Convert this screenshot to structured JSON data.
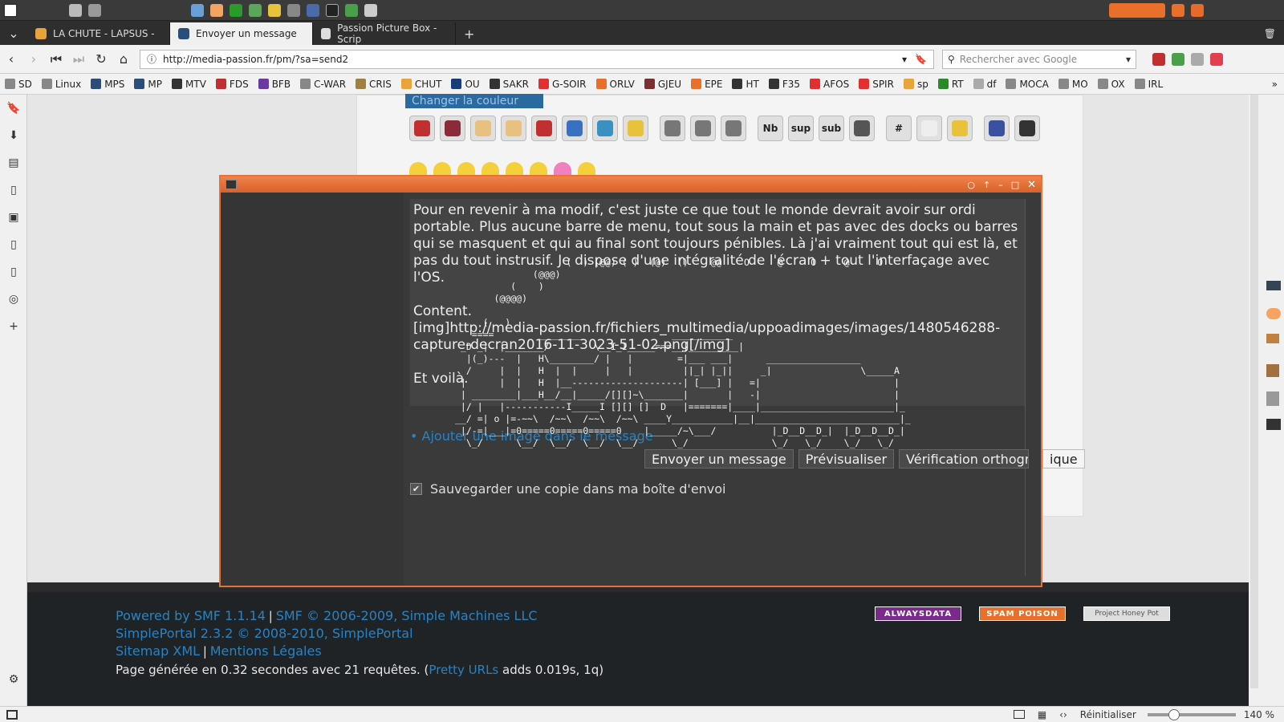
{
  "tabs": [
    {
      "label": "LA CHUTE - LAPSUS -",
      "active": false,
      "fav": "#e8a33a"
    },
    {
      "label": "Envoyer un message",
      "active": true,
      "fav": "#2a4d7a"
    },
    {
      "label": "Passion Picture Box - Scrip",
      "active": false,
      "fav": "#ddd"
    }
  ],
  "nav": {
    "url": "http://media-passion.fr/pm/?sa=send2",
    "search_placeholder": "Rechercher avec Google"
  },
  "bookmarks": [
    "SD",
    "Linux",
    "MPS",
    "MP",
    "MTV",
    "FDS",
    "BFB",
    "C-WAR",
    "CRIS",
    "CHUT",
    "OU",
    "SAKR",
    "G-SOIR",
    "ORLV",
    "GJEU",
    "EPE",
    "HT",
    "F35",
    "AFOS",
    "SPIR",
    "sp",
    "RT",
    "df",
    "MOCA",
    "MO",
    "OX",
    "IRL"
  ],
  "forum": {
    "change_color": "Changer la couleur",
    "add_image": "• Ajouter une image dans le message",
    "send": "Envoyer un message",
    "preview": "Prévisualiser",
    "spell": "Vérification orthogra",
    "spell_tail": "ique",
    "save_copy": "Sauvegarder une copie dans ma boîte d'envoi",
    "toolbar": [
      "",
      "",
      "",
      "",
      "",
      "",
      "",
      "",
      "",
      "",
      "",
      "Nb",
      "sup",
      "sub",
      "",
      "#",
      "",
      "",
      "",
      ""
    ]
  },
  "message": "Pour en revenir à ma modif, c'est juste ce que tout le monde devrait avoir sur ordi portable. Plus aucune barre de menu, tout sous la main et pas avec des docks ou barres qui se masquent et qui au final sont toujours pénibles. Là j'ai vraiment tout qui est là, et pas du tout instrusif. Je dispose d'une intégralité de l'écran + tout l'interfaçage avec l'OS.\n\nContent.\n[img]http://media-passion.fr/fichiers_multimedia/uppoadimages/images/1480546288-capture-decran2016-11-3023-51-02.png[/img]\n\nEt voilà.",
  "ascii": "                    (  ) (@@) ( )  (@)  ()    @@    O     @     O     @     O\n              (@@@)\n          (    )\n       (@@@@)\n\n     (   )\n   ====        ________                ___________\n _D _|  |_______/        \\__I_I_____===__|_________|\n  |(_)---  |   H\\________/ |   |        =|___ ___|      _________________\n  /     |  |   H  |  |     |   |         ||_| |_||     _|                \\_____A\n |      |  |   H  |__--------------------| [___] |   =|                        |\n | ________|___H__/__|_____/[][]~\\_______|       |   -|                        |\n |/ |   |-----------I_____I [][] []  D   |=======|____|________________________|_\n__/ =| o |=-~~\\  /~~\\  /~~\\  /~~\\ ____Y___________|__|__________________________|_\n |/-=|___|=0=====0=====0=====0    |_____/~\\___/          |_D__D__D_|  |_D__D__D_|\n  \\_/      \\__/  \\__/  \\__/  \\__/      \\_/               \\_/   \\_/    \\_/   \\_/",
  "footer": {
    "line1_a": "Powered by SMF 1.1.14",
    "line1_sep": "|",
    "line1_b": "SMF © 2006-2009, Simple Machines LLC",
    "line2": "SimplePortal 2.3.2 © 2008-2010, SimplePortal",
    "line3_a": "Sitemap XML",
    "line3_b": "Mentions Légales",
    "line4_a": "Page générée en 0.32 secondes avec 21 requêtes. (",
    "line4_link": "Pretty URLs",
    "line4_b": " adds 0.019s, 1q)",
    "badges": [
      "ALWAYSDATA",
      "SPAM POISON",
      "Project Honey Pot"
    ]
  },
  "status": {
    "reset": "Réinitialiser",
    "zoom": "140 %"
  }
}
